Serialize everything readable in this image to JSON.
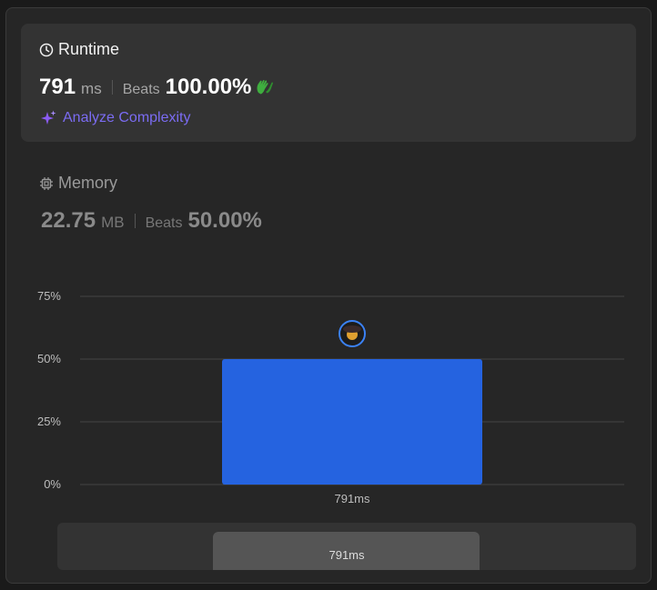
{
  "runtime": {
    "title": "Runtime",
    "value": "791",
    "unit": "ms",
    "beats_label": "Beats",
    "beats_value": "100.00%",
    "analyze_label": "Analyze Complexity"
  },
  "memory": {
    "title": "Memory",
    "value": "22.75",
    "unit": "MB",
    "beats_label": "Beats",
    "beats_value": "50.00%"
  },
  "colors": {
    "accent_purple": "#7b6cf3",
    "bar_blue": "#2563e0",
    "clap_green": "#3fae3f"
  },
  "chart_data": {
    "type": "bar",
    "categories": [
      "791ms"
    ],
    "values": [
      50
    ],
    "ylim": [
      0,
      75
    ],
    "yticks": [
      "0%",
      "25%",
      "50%",
      "75%"
    ],
    "grid": true,
    "xlabel": "",
    "ylabel": ""
  },
  "scroller": {
    "label": "791ms"
  }
}
